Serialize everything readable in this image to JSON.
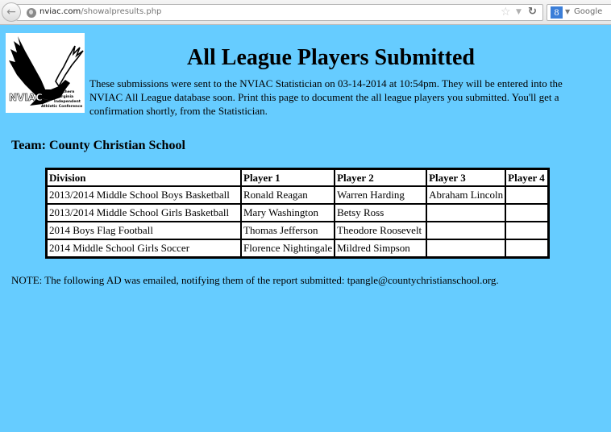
{
  "browser": {
    "url_domain": "nviac.com",
    "url_path": "/showalpresults.php",
    "search_placeholder": "Google",
    "search_engine_glyph": "8",
    "icons": {
      "back": "back-arrow-icon",
      "site": "globe-icon",
      "bookmark": "star-icon",
      "history": "dropdown-icon",
      "reload": "reload-icon",
      "engine": "google-icon"
    }
  },
  "logo": {
    "alt": "NVIAC",
    "acronym": "NVIAC",
    "lines": [
      "Northern",
      "Virginia",
      "Independent",
      "Athletic Conference"
    ]
  },
  "page": {
    "title": "All League Players Submitted",
    "intro": "These submissions were sent to the NVIAC Statistician on 03-14-2014 at 10:54pm. They will be entered into the NVIAC All League database soon. Print this page to document the all league players you submitted. You'll get a confirmation shortly, from the Statistician.",
    "team_heading": "Team: County Christian School",
    "note": "NOTE: The following AD was emailed, notifying them of the report submitted: tpangle@countychristianschool.org."
  },
  "table": {
    "headers": [
      "Division",
      "Player 1",
      "Player 2",
      "Player 3",
      "Player 4"
    ],
    "rows": [
      [
        "2013/2014 Middle School Boys Basketball",
        "Ronald Reagan",
        "Warren Harding",
        "Abraham Lincoln",
        ""
      ],
      [
        "2013/2014 Middle School Girls Basketball",
        "Mary Washington",
        "Betsy Ross",
        "",
        ""
      ],
      [
        "2014 Boys Flag Football",
        "Thomas Jefferson",
        "Theodore Roosevelt",
        "",
        ""
      ],
      [
        "2014 Middle School Girls Soccer",
        "Florence Nightingale",
        "Mildred Simpson",
        "",
        ""
      ]
    ]
  },
  "colors": {
    "page_background": "#66ccff",
    "table_background": "#ffffff",
    "text": "#000000"
  }
}
